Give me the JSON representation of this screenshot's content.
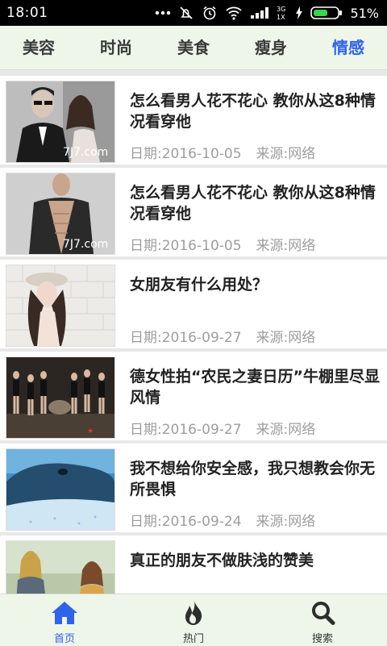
{
  "status_bar": {
    "time": "18:01",
    "network": "3G\n1X",
    "battery": "51%"
  },
  "tabs": [
    {
      "label": "美容",
      "active": false
    },
    {
      "label": "时尚",
      "active": false
    },
    {
      "label": "美食",
      "active": false
    },
    {
      "label": "瘦身",
      "active": false
    },
    {
      "label": "情感",
      "active": true
    }
  ],
  "articles": [
    {
      "title": "怎么看男人花不花心 教你从这8种情况看穿他",
      "date": "日期:2016-10-05",
      "source": "来源:网络",
      "image": "couple-photo"
    },
    {
      "title": "怎么看男人花不花心 教你从这8种情况看穿他",
      "date": "日期:2016-10-05",
      "source": "来源:网络",
      "image": "man-shirt-photo"
    },
    {
      "title": "女朋友有什么用处？",
      "date": "日期:2016-09-27",
      "source": "来源:网络",
      "image": "woman-hat-photo"
    },
    {
      "title": "德女性拍“农民之妻日历”牛棚里尽显风情",
      "date": "日期:2016-09-27",
      "source": "来源:网络",
      "image": "farm-group-photo"
    },
    {
      "title": "我不想给你安全感，我只想教会你无所畏惧",
      "date": "日期:2016-09-24",
      "source": "来源:网络",
      "image": "whale-photo"
    },
    {
      "title": "真正的朋友不做肤浅的赞美",
      "date": "",
      "source": "",
      "image": "friends-photo"
    }
  ],
  "bottom_nav": [
    {
      "label": "首页",
      "icon": "home-icon",
      "active": true
    },
    {
      "label": "热门",
      "icon": "flame-icon",
      "active": false
    },
    {
      "label": "搜索",
      "icon": "search-icon",
      "active": false
    }
  ],
  "colors": {
    "accent": "#2f64ea",
    "tab_bar_bg": "#eef6ea"
  }
}
